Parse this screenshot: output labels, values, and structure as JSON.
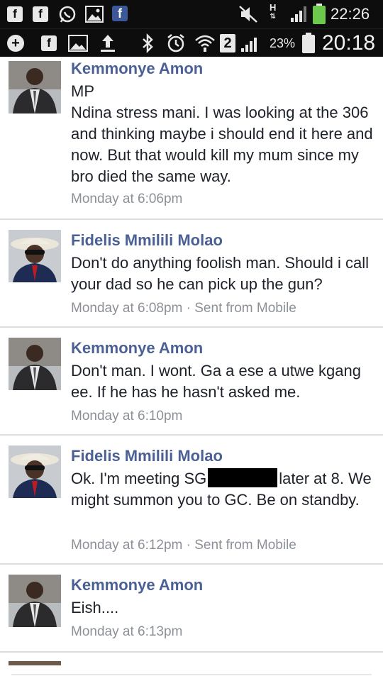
{
  "status_top": {
    "time": "22:26",
    "icons": [
      "facebook-lite-icon",
      "facebook-lite-icon",
      "whatsapp-icon",
      "gallery-icon",
      "facebook-icon",
      "mute-icon",
      "hspa-icon",
      "signal-icon",
      "battery-charging-icon"
    ]
  },
  "status_bottom": {
    "time": "20:18",
    "battery_pct": "23%",
    "sim_number": "2",
    "icons": [
      "add-icon",
      "facebook-lite-icon",
      "gallery-icon",
      "upload-icon",
      "bluetooth-icon",
      "alarm-icon",
      "wifi-icon",
      "signal-icon",
      "battery-icon"
    ]
  },
  "messages": [
    {
      "author": "Kemmonye Amon",
      "text_lines": [
        "MP",
        "Ndina stress mani. I was looking at the 306 and thinking maybe i should end it here and now. But that would kill my mum since my bro died the same way."
      ],
      "meta": "Monday at 6:06pm"
    },
    {
      "author": "Fidelis Mmilili Molao",
      "text": "Don't do anything foolish man. Should i call your dad so he can pick up the gun?",
      "meta": "Monday at 6:08pm · Sent from Mobile"
    },
    {
      "author": "Kemmonye Amon",
      "text": "Don't man. I wont. Ga a ese a utwe kgang ee. If he has he hasn't asked me.",
      "meta": "Monday at 6:10pm"
    },
    {
      "author": "Fidelis Mmilili Molao",
      "text_before": "Ok. I'm meeting SG",
      "text_after": "later at 8. We might summon you to GC. Be on standby.",
      "meta": "Monday at 6:12pm · Sent from Mobile"
    },
    {
      "author": "Kemmonye Amon",
      "text": "Eish....",
      "meta": "Monday at 6:13pm"
    }
  ]
}
